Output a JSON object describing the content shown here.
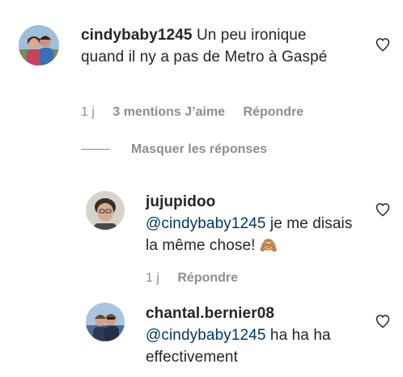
{
  "comments": [
    {
      "username": "cindybaby1245",
      "text": "Un peu ironique quand il ny a pas de Metro à Gaspé",
      "time": "1 j",
      "likes": "3 mentions J’aime",
      "reply_label": "Répondre"
    }
  ],
  "replies_toggle": "Masquer les réponses",
  "replies": [
    {
      "username": "jujupidoo",
      "mention": "@cindybaby1245",
      "text": "je me disais la même chose!",
      "emoji": "🙈",
      "time": "1 j",
      "reply_label": "Répondre"
    },
    {
      "username": "chantal.bernier08",
      "mention": "@cindybaby1245",
      "text": "ha ha ha effectivement"
    }
  ]
}
